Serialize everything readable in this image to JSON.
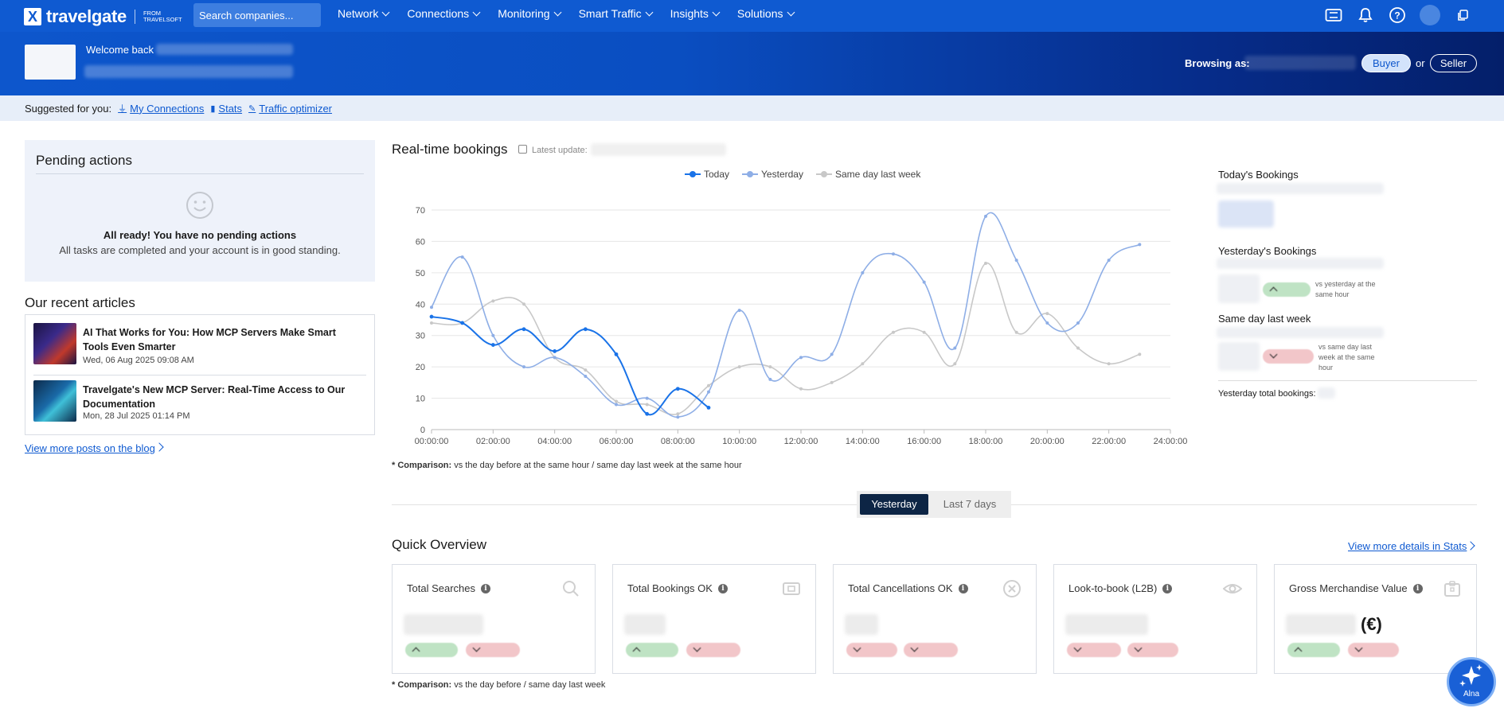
{
  "nav": {
    "brand": "travelgate",
    "brand_from": "FROM",
    "brand_from_company": "TRAVELSOFT",
    "search_placeholder": "Search companies...",
    "menu": [
      "Network",
      "Connections",
      "Monitoring",
      "Smart Traffic",
      "Insights",
      "Solutions"
    ],
    "icons": [
      "ticket-icon",
      "bell-icon",
      "help-icon",
      "avatar",
      "copy-icon"
    ]
  },
  "banner": {
    "welcome": "Welcome back",
    "browsing_label": "Browsing as:",
    "buyer": "Buyer",
    "or": "or",
    "seller": "Seller"
  },
  "suggested": {
    "label": "Suggested for you:",
    "links": [
      "My Connections",
      "Stats",
      "Traffic optimizer"
    ]
  },
  "pending": {
    "title": "Pending actions",
    "status_title": "All ready! You have no pending actions",
    "status_sub": "All tasks are completed and your account is in good standing."
  },
  "articles": {
    "title": "Our recent articles",
    "items": [
      {
        "title": "AI That Works for You: How MCP Servers Make Smart Tools Even Smarter",
        "date": "Wed, 06 Aug 2025 09:08 AM"
      },
      {
        "title": "Travelgate's New MCP Server: Real-Time Access to Our Documentation",
        "date": "Mon, 28 Jul 2025 01:14 PM"
      }
    ],
    "more_link": "View more posts on the blog"
  },
  "realtime": {
    "title": "Real-time bookings",
    "latest_update": "Latest update:",
    "comparison_label": "* Comparison:",
    "comparison_text": "vs the day before at the same hour / same day last week at the same hour"
  },
  "chart_data": {
    "type": "line",
    "ylim": [
      0,
      70
    ],
    "yticks": [
      0,
      10,
      20,
      30,
      40,
      50,
      60,
      70
    ],
    "xticks": [
      "00:00:00",
      "02:00:00",
      "04:00:00",
      "06:00:00",
      "08:00:00",
      "10:00:00",
      "12:00:00",
      "14:00:00",
      "16:00:00",
      "18:00:00",
      "20:00:00",
      "22:00:00",
      "24:00:00"
    ],
    "legend": "top-center",
    "grid": true,
    "series": [
      {
        "name": "Today",
        "color": "#1a73e8",
        "x": [
          0,
          1,
          2,
          3,
          4,
          5,
          6,
          7,
          8,
          9
        ],
        "values": [
          36,
          34,
          27,
          32,
          25,
          32,
          24,
          5,
          13,
          7
        ]
      },
      {
        "name": "Yesterday",
        "color": "#8eaee6",
        "x": [
          0,
          1,
          2,
          3,
          4,
          5,
          6,
          7,
          8,
          9,
          10,
          11,
          12,
          13,
          14,
          15,
          16,
          17,
          18,
          19,
          20,
          21,
          22,
          23
        ],
        "values": [
          39,
          55,
          30,
          20,
          23,
          17,
          8,
          10,
          4,
          12,
          38,
          16,
          23,
          24,
          50,
          56,
          47,
          26,
          68,
          54,
          34,
          34,
          54,
          59
        ]
      },
      {
        "name": "Same day last week",
        "color": "#c8c8c8",
        "x": [
          0,
          1,
          2,
          3,
          4,
          5,
          6,
          7,
          8,
          9,
          10,
          11,
          12,
          13,
          14,
          15,
          16,
          17,
          18,
          19,
          20,
          21,
          22,
          23
        ],
        "values": [
          34,
          34,
          41,
          40,
          23,
          19,
          9,
          8,
          5,
          14,
          20,
          20,
          13,
          15,
          21,
          31,
          31,
          21,
          53,
          31,
          37,
          26,
          21,
          24
        ]
      }
    ]
  },
  "right_stats": {
    "today": "Today's Bookings",
    "yesterday": "Yesterday's Bookings",
    "yesterday_note": "vs yesterday at the same hour",
    "last_week": "Same day last week",
    "last_week_note": "vs same day last week at the same hour",
    "total": "Yesterday total bookings:"
  },
  "toggle": {
    "yesterday": "Yesterday",
    "last7": "Last 7 days"
  },
  "overview": {
    "title": "Quick Overview",
    "more": "View more details in Stats",
    "cards": [
      {
        "title": "Total Searches",
        "icon": "search-icon"
      },
      {
        "title": "Total Bookings OK",
        "icon": "ticket-icon"
      },
      {
        "title": "Total Cancellations OK",
        "icon": "cancel-icon"
      },
      {
        "title": "Look-to-book (L2B)",
        "icon": "eye-icon"
      },
      {
        "title": "Gross Merchandise Value",
        "icon": "wallet-icon",
        "suffix": "(€)"
      }
    ],
    "comparison_label": "* Comparison:",
    "comparison_text": "vs the day before / same day last week"
  },
  "assistant": {
    "label": "Alna"
  }
}
